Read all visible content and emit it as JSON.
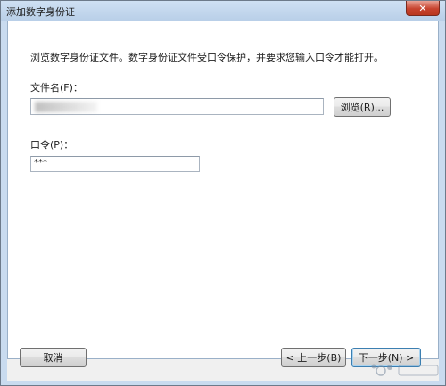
{
  "window": {
    "title": "添加数字身份证",
    "close_symbol": "✕"
  },
  "content": {
    "instructions": "浏览数字身份证文件。数字身份证文件受口令保护，并要求您输入口令才能打开。",
    "file_label": "文件名(F)：",
    "file_value": "",
    "browse_label": "浏览(R)...",
    "password_label": "口令(P)：",
    "password_value": "***"
  },
  "footer": {
    "cancel_label": "取消",
    "back_label": "< 上一步(B)",
    "next_label": "下一步(N) >"
  }
}
